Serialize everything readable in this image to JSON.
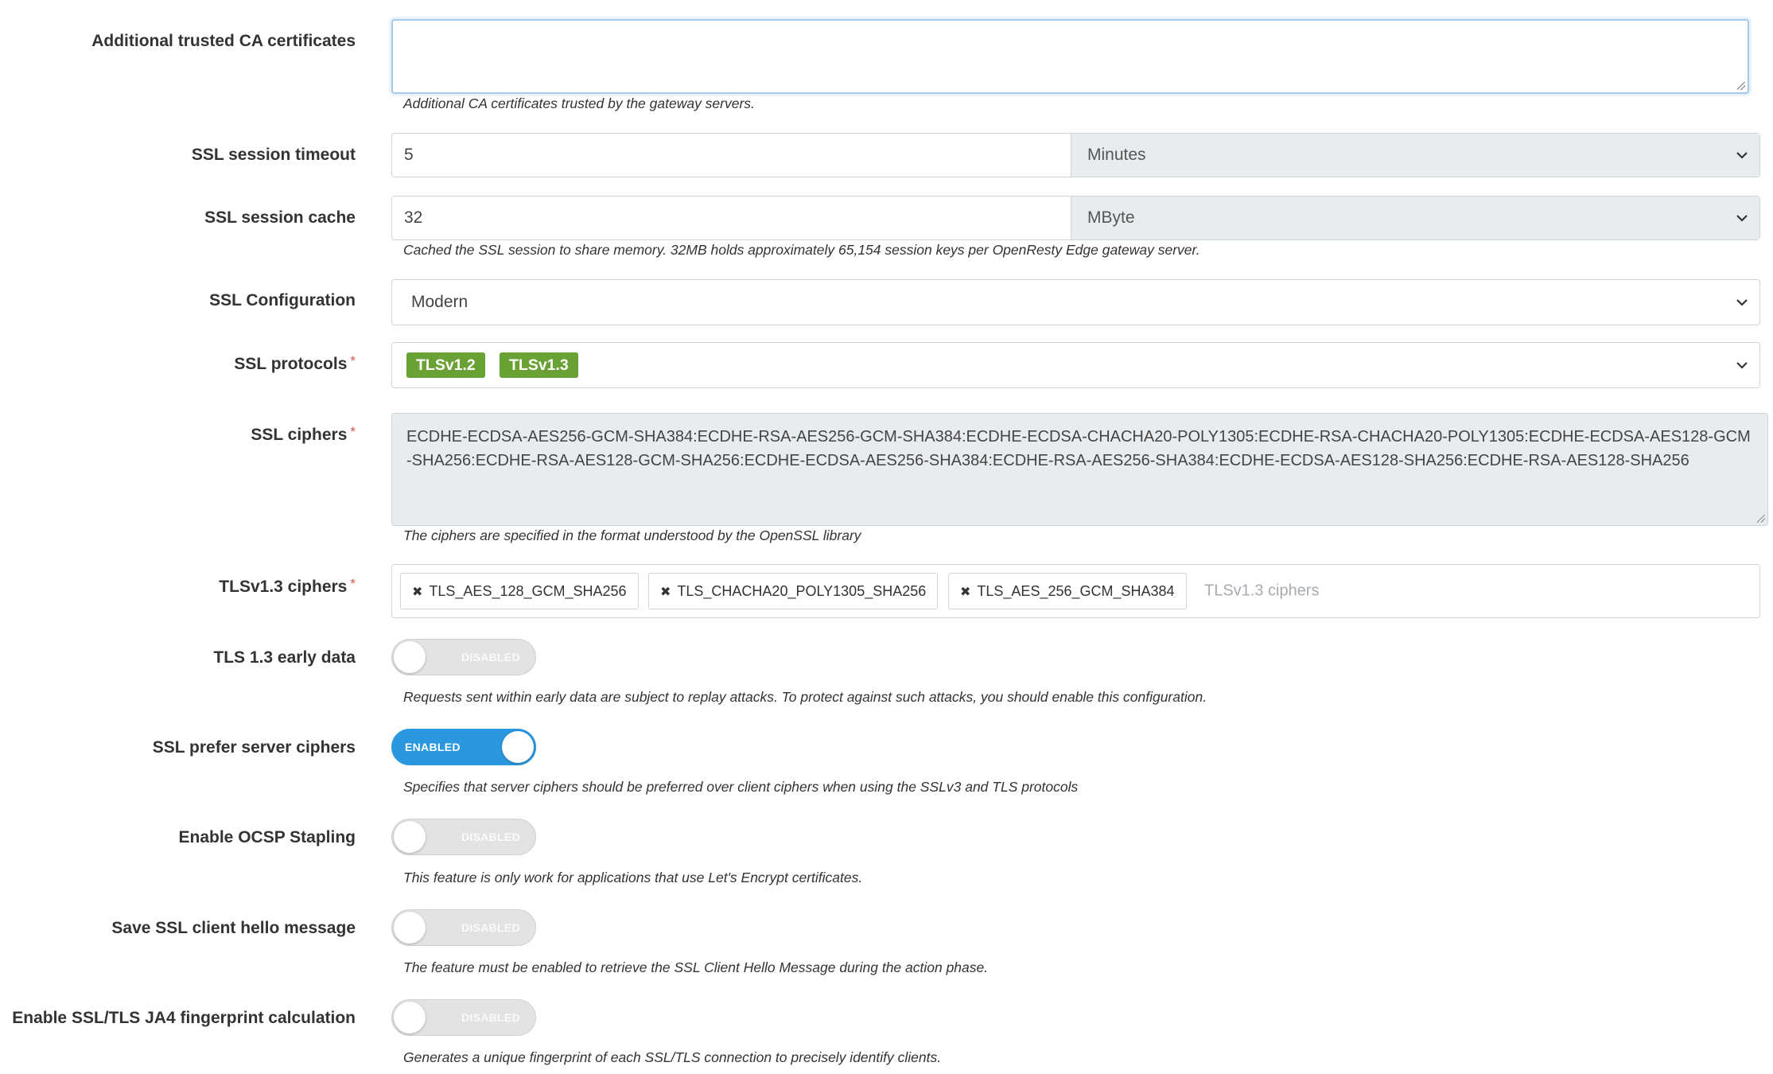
{
  "additional_ca": {
    "label": "Additional trusted CA certificates",
    "value": "",
    "help": "Additional CA certificates trusted by the gateway servers."
  },
  "session_timeout": {
    "label": "SSL session timeout",
    "value": "5",
    "unit": "Minutes"
  },
  "session_cache": {
    "label": "SSL session cache",
    "value": "32",
    "unit": "MByte",
    "help": "Cached the SSL session to share memory. 32MB holds approximately 65,154 session keys per OpenResty Edge gateway server."
  },
  "ssl_configuration": {
    "label": "SSL Configuration",
    "value": "Modern"
  },
  "ssl_protocols": {
    "label": "SSL protocols",
    "required_mark": "*",
    "tags": [
      "TLSv1.2",
      "TLSv1.3"
    ]
  },
  "ssl_ciphers": {
    "label": "SSL ciphers",
    "required_mark": "*",
    "value": "ECDHE-ECDSA-AES256-GCM-SHA384:ECDHE-RSA-AES256-GCM-SHA384:ECDHE-ECDSA-CHACHA20-POLY1305:ECDHE-RSA-CHACHA20-POLY1305:ECDHE-ECDSA-AES128-GCM-SHA256:ECDHE-RSA-AES128-GCM-SHA256:ECDHE-ECDSA-AES256-SHA384:ECDHE-RSA-AES256-SHA384:ECDHE-ECDSA-AES128-SHA256:ECDHE-RSA-AES128-SHA256",
    "help": "The ciphers are specified in the format understood by the OpenSSL library"
  },
  "tls13_ciphers": {
    "label": "TLSv1.3 ciphers",
    "required_mark": "*",
    "chips": [
      "TLS_AES_128_GCM_SHA256",
      "TLS_CHACHA20_POLY1305_SHA256",
      "TLS_AES_256_GCM_SHA384"
    ],
    "placeholder": "TLSv1.3 ciphers",
    "remove_glyph": "✖"
  },
  "early_data": {
    "label": "TLS 1.3 early data",
    "state": "DISABLED",
    "help": "Requests sent within early data are subject to replay attacks. To protect against such attacks, you should enable this configuration."
  },
  "prefer_server_ciphers": {
    "label": "SSL prefer server ciphers",
    "state": "ENABLED",
    "help": "Specifies that server ciphers should be preferred over client ciphers when using the SSLv3 and TLS protocols"
  },
  "ocsp_stapling": {
    "label": "Enable OCSP Stapling",
    "state": "DISABLED",
    "help": "This feature is only work for applications that use Let's Encrypt certificates."
  },
  "client_hello": {
    "label": "Save SSL client hello message",
    "state": "DISABLED",
    "help": "The feature must be enabled to retrieve the SSL Client Hello Message during the action phase."
  },
  "ja4": {
    "label": "Enable SSL/TLS JA4 fingerprint calculation",
    "state": "DISABLED",
    "help": "Generates a unique fingerprint of each SSL/TLS connection to precisely identify clients."
  },
  "colors": {
    "tag_green": "#6aa134",
    "toggle_on": "#2a97df",
    "toggle_off": "#e3e3e3",
    "required": "#d9534f"
  }
}
